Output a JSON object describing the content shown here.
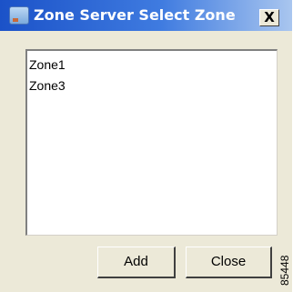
{
  "window": {
    "title": "Zone Server Select Zone",
    "close_label": "X"
  },
  "zone_list": {
    "items": [
      {
        "label": "Zone1"
      },
      {
        "label": "Zone3"
      }
    ]
  },
  "buttons": {
    "add_label": "Add",
    "close_label": "Close"
  },
  "figure_number": "85448",
  "colors": {
    "titlebar_start": "#1b52c8",
    "titlebar_end": "#a9c6ef",
    "dialog_bg": "#ece9d8",
    "list_bg": "#ffffff"
  },
  "icons": {
    "app": "app-window-icon",
    "close": "close-icon"
  }
}
